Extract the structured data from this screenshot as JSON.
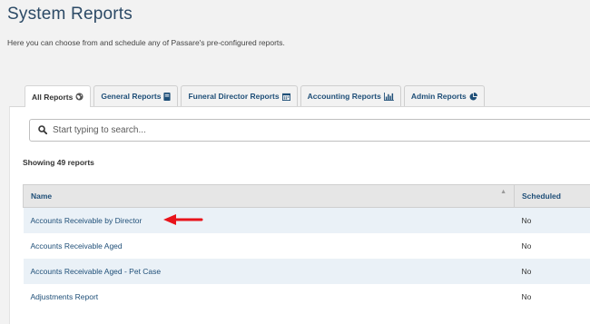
{
  "page": {
    "title": "System Reports",
    "subtitle": "Here you can choose from and schedule any of Passare's pre-configured reports."
  },
  "tabs": [
    {
      "label": "All Reports",
      "icon": "globe-icon",
      "active": true
    },
    {
      "label": "General Reports",
      "icon": "book-icon",
      "active": false
    },
    {
      "label": "Funeral Director Reports",
      "icon": "calendar-icon",
      "active": false
    },
    {
      "label": "Accounting Reports",
      "icon": "bar-chart-icon",
      "active": false
    },
    {
      "label": "Admin Reports",
      "icon": "pie-chart-icon",
      "active": false
    }
  ],
  "search": {
    "placeholder": "Start typing to search..."
  },
  "results": {
    "count_text": "Showing 49 reports"
  },
  "table": {
    "columns": [
      "Name",
      "Scheduled"
    ],
    "rows": [
      {
        "name": "Accounts Receivable by Director",
        "scheduled": "No"
      },
      {
        "name": "Accounts Receivable Aged",
        "scheduled": "No"
      },
      {
        "name": "Accounts Receivable Aged - Pet Case",
        "scheduled": "No"
      },
      {
        "name": "Adjustments Report",
        "scheduled": "No"
      }
    ]
  },
  "colors": {
    "link": "#1f4f78",
    "title": "#2c4a66",
    "stripe": "#eaf1f7",
    "annotation_arrow": "#e8141b"
  }
}
